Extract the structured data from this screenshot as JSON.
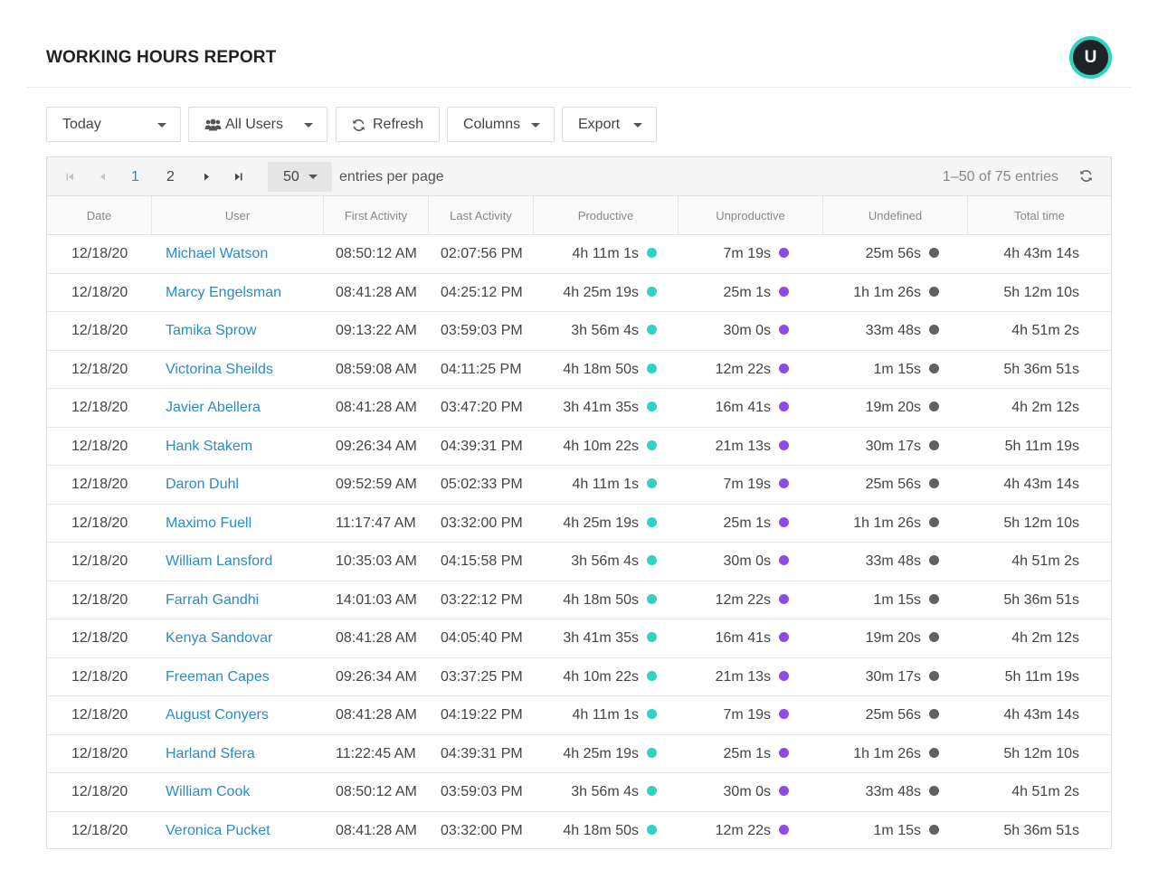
{
  "header": {
    "title": "WORKING HOURS REPORT",
    "avatar_initial": "U"
  },
  "toolbar": {
    "date_range": "Today",
    "users_filter": "All Users",
    "refresh": "Refresh",
    "columns": "Columns",
    "export": "Export"
  },
  "pager": {
    "pages": [
      "1",
      "2"
    ],
    "current_page": "1",
    "per_page": "50",
    "per_page_label": "entries per page",
    "entries_info": "1–50 of 75 entries"
  },
  "colors": {
    "productive": "#2fd3c0",
    "unproductive": "#8c4be8",
    "undefined": "#616161",
    "link": "#2a8bc9",
    "accent": "#2fd3c0"
  },
  "table": {
    "columns": [
      "Date",
      "User",
      "First Activity",
      "Last Activity",
      "Productive",
      "Unproductive",
      "Undefined",
      "Total time"
    ],
    "rows": [
      {
        "date": "12/18/20",
        "user": "Michael Watson",
        "first": "08:50:12 AM",
        "last": "02:07:56 PM",
        "productive": "4h 11m 1s",
        "unproductive": "7m 19s",
        "undefined": "25m 56s",
        "total": "4h 43m 14s"
      },
      {
        "date": "12/18/20",
        "user": "Marcy Engelsman",
        "first": "08:41:28 AM",
        "last": "04:25:12 PM",
        "productive": "4h 25m 19s",
        "unproductive": "25m 1s",
        "undefined": "1h 1m 26s",
        "total": "5h 12m 10s"
      },
      {
        "date": "12/18/20",
        "user": "Tamika Sprow",
        "first": "09:13:22 AM",
        "last": "03:59:03 PM",
        "productive": "3h 56m 4s",
        "unproductive": "30m 0s",
        "undefined": "33m 48s",
        "total": "4h 51m 2s"
      },
      {
        "date": "12/18/20",
        "user": "Victorina Sheilds",
        "first": "08:59:08 AM",
        "last": "04:11:25 PM",
        "productive": "4h 18m 50s",
        "unproductive": "12m 22s",
        "undefined": "1m 15s",
        "total": "5h 36m 51s"
      },
      {
        "date": "12/18/20",
        "user": "Javier Abellera",
        "first": "08:41:28 AM",
        "last": "03:47:20 PM",
        "productive": "3h 41m 35s",
        "unproductive": "16m 41s",
        "undefined": "19m 20s",
        "total": "4h 2m 12s"
      },
      {
        "date": "12/18/20",
        "user": "Hank Stakem",
        "first": "09:26:34 AM",
        "last": "04:39:31 PM",
        "productive": "4h 10m 22s",
        "unproductive": "21m 13s",
        "undefined": "30m 17s",
        "total": "5h 11m 19s"
      },
      {
        "date": "12/18/20",
        "user": "Daron Duhl",
        "first": "09:52:59 AM",
        "last": "05:02:33 PM",
        "productive": "4h 11m 1s",
        "unproductive": "7m 19s",
        "undefined": "25m 56s",
        "total": "4h 43m 14s"
      },
      {
        "date": "12/18/20",
        "user": "Maximo Fuell",
        "first": "11:17:47 AM",
        "last": "03:32:00 PM",
        "productive": "4h 25m 19s",
        "unproductive": "25m 1s",
        "undefined": "1h 1m 26s",
        "total": "5h 12m 10s"
      },
      {
        "date": "12/18/20",
        "user": "William Lansford",
        "first": "10:35:03 AM",
        "last": "04:15:58 PM",
        "productive": "3h 56m 4s",
        "unproductive": "30m 0s",
        "undefined": "33m 48s",
        "total": "4h 51m 2s"
      },
      {
        "date": "12/18/20",
        "user": "Farrah Gandhi",
        "first": "14:01:03 AM",
        "last": "03:22:12 PM",
        "productive": "4h 18m 50s",
        "unproductive": "12m 22s",
        "undefined": "1m 15s",
        "total": "5h 36m 51s"
      },
      {
        "date": "12/18/20",
        "user": "Kenya Sandovar",
        "first": "08:41:28 AM",
        "last": "04:05:40 PM",
        "productive": "3h 41m 35s",
        "unproductive": "16m 41s",
        "undefined": "19m 20s",
        "total": "4h 2m 12s"
      },
      {
        "date": "12/18/20",
        "user": "Freeman Capes",
        "first": "09:26:34 AM",
        "last": "03:37:25 PM",
        "productive": "4h 10m 22s",
        "unproductive": "21m 13s",
        "undefined": "30m 17s",
        "total": "5h 11m 19s"
      },
      {
        "date": "12/18/20",
        "user": "August Conyers",
        "first": "08:41:28 AM",
        "last": "04:19:22 PM",
        "productive": "4h 11m 1s",
        "unproductive": "7m 19s",
        "undefined": "25m 56s",
        "total": "4h 43m 14s"
      },
      {
        "date": "12/18/20",
        "user": "Harland Sfera",
        "first": "11:22:45 AM",
        "last": "04:39:31 PM",
        "productive": "4h 25m 19s",
        "unproductive": "25m 1s",
        "undefined": "1h 1m 26s",
        "total": "5h 12m 10s"
      },
      {
        "date": "12/18/20",
        "user": "William Cook",
        "first": "08:50:12 AM",
        "last": "03:59:03 PM",
        "productive": "3h 56m 4s",
        "unproductive": "30m 0s",
        "undefined": "33m 48s",
        "total": "4h 51m 2s"
      },
      {
        "date": "12/18/20",
        "user": "Veronica Pucket",
        "first": "08:41:28 AM",
        "last": "03:32:00 PM",
        "productive": "4h 18m 50s",
        "unproductive": "12m 22s",
        "undefined": "1m 15s",
        "total": "5h 36m 51s"
      }
    ]
  }
}
